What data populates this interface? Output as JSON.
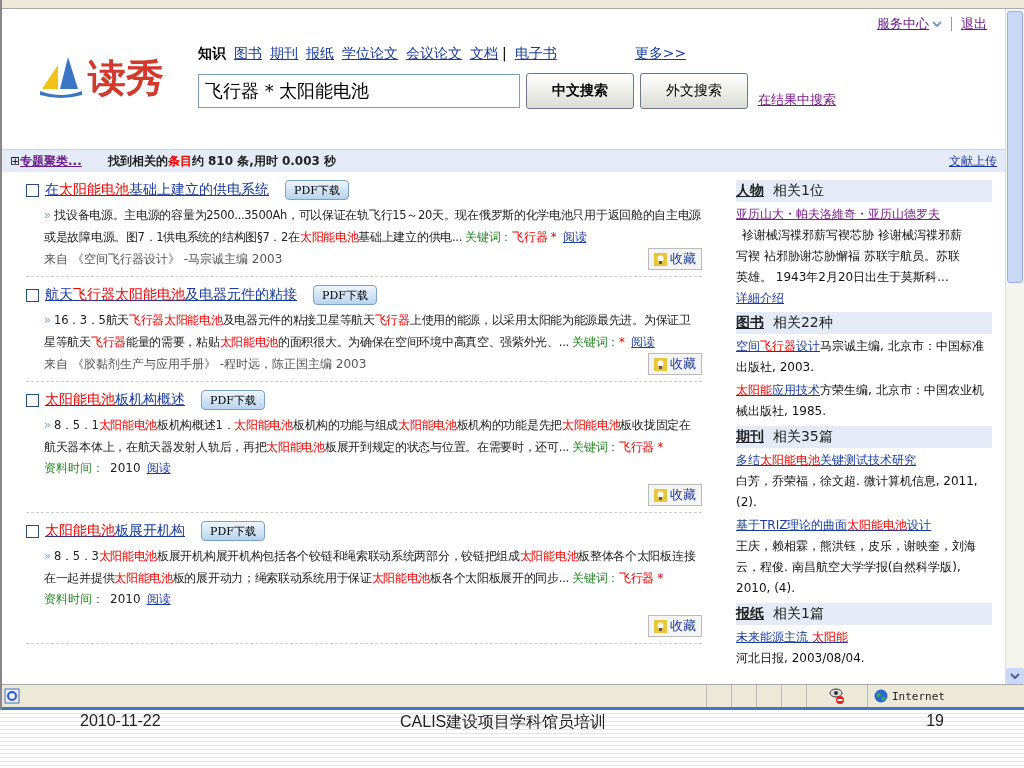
{
  "header": {
    "logo_text": "读秀",
    "service": "服务中心",
    "logout": "退出",
    "nav": [
      {
        "label": "知识",
        "selected": true
      },
      {
        "label": "图书",
        "selected": false
      },
      {
        "label": "期刊",
        "selected": false
      },
      {
        "label": "报纸",
        "selected": false
      },
      {
        "label": "学位论文",
        "selected": false
      },
      {
        "label": "会议论文",
        "selected": false
      },
      {
        "label": "文档",
        "selected": false
      },
      {
        "label": "电子书",
        "selected": false
      }
    ],
    "separator": "|",
    "more": "更多>>",
    "search_value": "飞行器 * 太阳能电池",
    "search_cn": "中文搜索",
    "search_foreign": "外文搜索",
    "search_within": "在结果中搜索"
  },
  "summary_bar": {
    "expand": "⊞",
    "cluster": "专题聚类...",
    "found": [
      {
        "t": "找到相关的",
        "hit": false
      },
      {
        "t": "条目",
        "hit": true
      },
      {
        "t": "约 810 条,用时 0.003 秒",
        "hit": false
      }
    ],
    "upload": "文献上传"
  },
  "results": [
    {
      "kind": "source",
      "checked": false,
      "marker": "»",
      "title": [
        {
          "t": "在",
          "hit": false
        },
        {
          "t": "太阳能电池",
          "hit": true
        },
        {
          "t": "基础上建立的供电系统",
          "hit": false
        }
      ],
      "pdf": "PDF下载",
      "snippet": [
        {
          "t": "找设备电源。主电源的容量为2500...3500Ah，可以保证在轨飞行15～20天。现在俄罗斯的化学电池只用于返回舱的自主电源或是故障电源。图7．1供电系统的结构图§7．2在",
          "hit": false
        },
        {
          "t": "太阳能电池",
          "hit": true
        },
        {
          "t": "基础上建立的供电...",
          "hit": false
        }
      ],
      "keyword_label": "关键词：",
      "keyword": "飞行器 *",
      "read": "阅读",
      "source": "来自 《空间飞行器设计》 -马宗诚主编 2003",
      "save": "收藏"
    },
    {
      "kind": "source",
      "checked": false,
      "marker": "»",
      "title": [
        {
          "t": "航天",
          "hit": false
        },
        {
          "t": "飞行器太阳能电池",
          "hit": true
        },
        {
          "t": "及电器元件的粘接",
          "hit": false
        }
      ],
      "pdf": "PDF下载",
      "snippet": [
        {
          "t": "16．3．5航天",
          "hit": false
        },
        {
          "t": "飞行器太阳能电池",
          "hit": true
        },
        {
          "t": "及电器元件的粘接卫星等航天",
          "hit": false
        },
        {
          "t": "飞行器",
          "hit": true
        },
        {
          "t": "上使用的能源，以采用太阳能为能源最先进。为保证卫星等航天",
          "hit": false
        },
        {
          "t": "飞行器",
          "hit": true
        },
        {
          "t": "能量的需要，粘贴",
          "hit": false
        },
        {
          "t": "太阳能电池",
          "hit": true
        },
        {
          "t": "的面积很大。为确保在空间环境中高真空、强紫外光、...",
          "hit": false
        }
      ],
      "keyword_label": "关键词：",
      "keyword": "*",
      "read": "阅读",
      "source": "来自 《胶黏剂生产与应用手册》 -程时远，陈正国主编 2003",
      "save": "收藏"
    },
    {
      "kind": "dated",
      "checked": false,
      "marker": "»",
      "title": [
        {
          "t": "太阳能电池",
          "hit": true
        },
        {
          "t": "板机构概述",
          "hit": false
        }
      ],
      "pdf": "PDF下载",
      "snippet": [
        {
          "t": "8．5．1",
          "hit": false
        },
        {
          "t": "太阳能电池",
          "hit": true
        },
        {
          "t": "板机构概述1．",
          "hit": false
        },
        {
          "t": "太阳能电池",
          "hit": true
        },
        {
          "t": "板机构的功能与组成",
          "hit": false
        },
        {
          "t": "太阳能电池",
          "hit": true
        },
        {
          "t": "板机构的功能是先把",
          "hit": false
        },
        {
          "t": "太阳能电池",
          "hit": true
        },
        {
          "t": "板收拢固定在航天器本体上，在航天器发射人轨后，再把",
          "hit": false
        },
        {
          "t": "太阳能电池",
          "hit": true
        },
        {
          "t": "板展开到规定的状态与位置。在需要时，还可...",
          "hit": false
        }
      ],
      "keyword_label": "关键词：",
      "keyword": "飞行器 *",
      "date_label": "资料时间：",
      "date": "2010",
      "read": "阅读",
      "save": "收藏"
    },
    {
      "kind": "dated",
      "checked": false,
      "marker": "»",
      "title": [
        {
          "t": "太阳能电池",
          "hit": true
        },
        {
          "t": "板展开机构",
          "hit": false
        }
      ],
      "pdf": "PDF下载",
      "snippet": [
        {
          "t": "8．5．3",
          "hit": false
        },
        {
          "t": "太阳能电池",
          "hit": true
        },
        {
          "t": "板展开机构展开机构包括各个铰链和绳索联动系统两部分，铰链把组成",
          "hit": false
        },
        {
          "t": "太阳能电池",
          "hit": true
        },
        {
          "t": "板整体各个太阳板连接在一起并提供",
          "hit": false
        },
        {
          "t": "太阳能电池",
          "hit": true
        },
        {
          "t": "板的展开动力；绳索联动系统用于保证",
          "hit": false
        },
        {
          "t": "太阳能电池",
          "hit": true
        },
        {
          "t": "板各个太阳板展开的同步...",
          "hit": false
        }
      ],
      "keyword_label": "关键词：",
      "keyword": "飞行器 *",
      "date_label": "资料时间：",
      "date": "2010",
      "read": "阅读",
      "save": "收藏"
    }
  ],
  "sidebar": [
    {
      "category": "人物",
      "count": "相关1位",
      "items": [
        {
          "kind": "block",
          "link": [
            {
              "t": "亚历山大・帕夫洛維奇・亚历山德罗夫",
              "hit": false
            }
          ],
          "text": "袗谢械泻褋邪薪写褉芯胁 袗谢械泻褋邪薪写褉 袩邪胁谢芯胁懈褔 苏联宇航员。苏联英雄。 1943年2月20日出生于莫斯科..."
        }
      ],
      "more": "详細介绍"
    },
    {
      "category": "图书",
      "count": "相关22种",
      "items": [
        {
          "kind": "inline",
          "link": [
            {
              "t": "空间",
              "hit": false
            },
            {
              "t": "飞行器",
              "hit": true
            },
            {
              "t": "设计",
              "hit": false
            }
          ],
          "text": "马宗诚主编, 北京市：中国标准出版社, 2003."
        },
        {
          "kind": "inline",
          "link": [
            {
              "t": "太阳能",
              "hit": true
            },
            {
              "t": "应用技术",
              "hit": false
            }
          ],
          "text": "方荣生编, 北京市：中国农业机械出版社, 1985."
        }
      ]
    },
    {
      "category": "期刊",
      "count": "相关35篇",
      "items": [
        {
          "kind": "block",
          "link": [
            {
              "t": "多结",
              "hit": false
            },
            {
              "t": "太阳能电池",
              "hit": true
            },
            {
              "t": "关键测试技术研究",
              "hit": false
            }
          ],
          "text": "白芳，乔荣福，徐文超. 微计算机信息, 2011, (2)."
        },
        {
          "kind": "block",
          "link": [
            {
              "t": "基于TRIZ理论的曲面",
              "hit": false
            },
            {
              "t": "太阳能电池",
              "hit": true
            },
            {
              "t": "设计",
              "hit": false
            }
          ],
          "text": "王庆，赖相霖，熊洪钰，皮乐，谢映奎，刘海云，程俊. 南昌航空大学学报(自然科学版), 2010, (4)."
        }
      ]
    },
    {
      "category": "报纸",
      "count": "相关1篇",
      "items": [
        {
          "kind": "block",
          "link": [
            {
              "t": "未来能源主流 ",
              "hit": false
            },
            {
              "t": "太阳能",
              "hit": true
            }
          ],
          "text": "河北日报, 2003/08/04."
        }
      ]
    }
  ],
  "status_bar": {
    "zone": "Internet"
  },
  "slide_footer": {
    "date": "2010-11-22",
    "title": "CALIS建设项目学科馆员培训",
    "page": "19"
  }
}
